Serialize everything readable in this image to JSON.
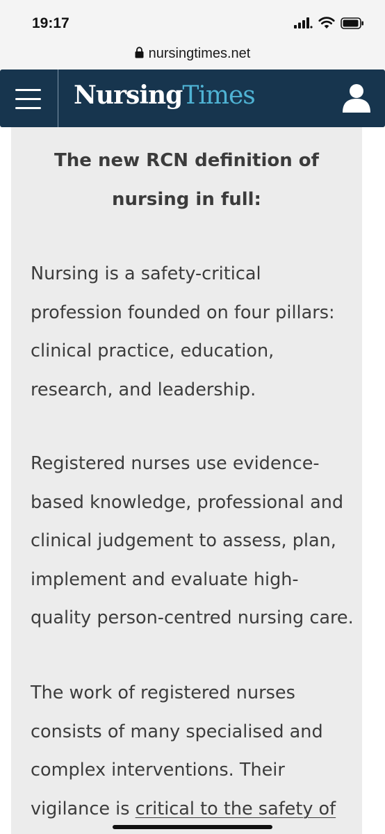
{
  "status_bar": {
    "time": "19:17",
    "icons": [
      "cellular-signal-icon",
      "wifi-icon",
      "battery-icon"
    ]
  },
  "browser": {
    "url": "nursingtimes.net",
    "lock_icon": "lock-icon"
  },
  "header": {
    "logo_part1": "Nursing",
    "logo_part2": "Times",
    "menu_icon": "hamburger-menu-icon",
    "user_icon": "user-account-icon",
    "colors": {
      "background": "#17354e",
      "logo_accent": "#4fb3d4"
    }
  },
  "article": {
    "heading_line1": "The new RCN definition of",
    "heading_line2": "nursing in full:",
    "paragraphs": [
      {
        "lines": [
          "Nursing is a safety-critical",
          "profession founded on four pillars:",
          "clinical practice, education,",
          "research, and leadership."
        ]
      },
      {
        "lines": [
          "Registered nurses use evidence-",
          "based knowledge, professional and",
          "clinical judgement to assess, plan,",
          "implement and evaluate high-",
          "quality person-centred nursing care."
        ]
      },
      {
        "lines": [
          "The work of registered nurses",
          "consists of many specialised and",
          "complex interventions. Their"
        ],
        "last_line_plain": "vigilance is ",
        "last_line_underlined": "critical to the safety of"
      }
    ]
  }
}
